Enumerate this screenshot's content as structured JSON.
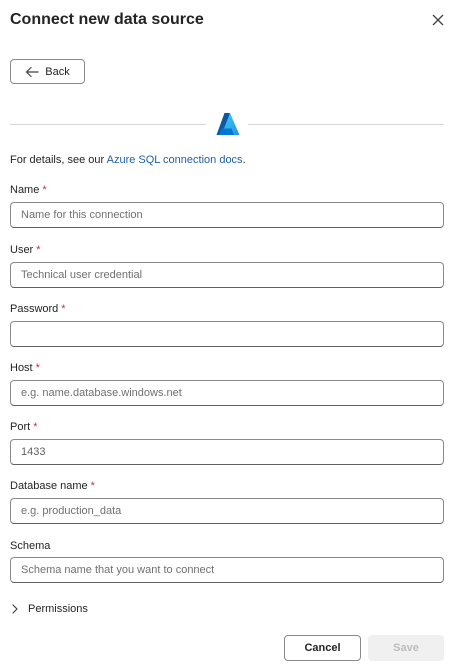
{
  "dialog": {
    "title": "Connect new data source",
    "back_label": "Back",
    "logo_name": "azure-logo",
    "details_prefix": "For details, see our ",
    "details_link": "Azure SQL connection docs",
    "details_suffix": "."
  },
  "fields": {
    "name": {
      "label": "Name",
      "required": "*",
      "value": "",
      "placeholder": "Name for this connection"
    },
    "user": {
      "label": "User",
      "required": "*",
      "value": "",
      "placeholder": "Technical user credential"
    },
    "password": {
      "label": "Password",
      "required": "*",
      "value": "",
      "placeholder": ""
    },
    "host": {
      "label": "Host",
      "required": "*",
      "value": "",
      "placeholder": "e.g. name.database.windows.net"
    },
    "port": {
      "label": "Port",
      "required": "*",
      "value": "1433",
      "placeholder": ""
    },
    "database": {
      "label": "Database name",
      "required": "*",
      "value": "",
      "placeholder": "e.g. production_data"
    },
    "schema": {
      "label": "Schema",
      "value": "",
      "placeholder": "Schema name that you want to connect"
    }
  },
  "permissions": {
    "label": "Permissions"
  },
  "footer": {
    "cancel_label": "Cancel",
    "save_label": "Save"
  },
  "colors": {
    "accent_link": "#1f5fa8",
    "required": "#c4314b",
    "azure_blue": "#0078d4"
  }
}
